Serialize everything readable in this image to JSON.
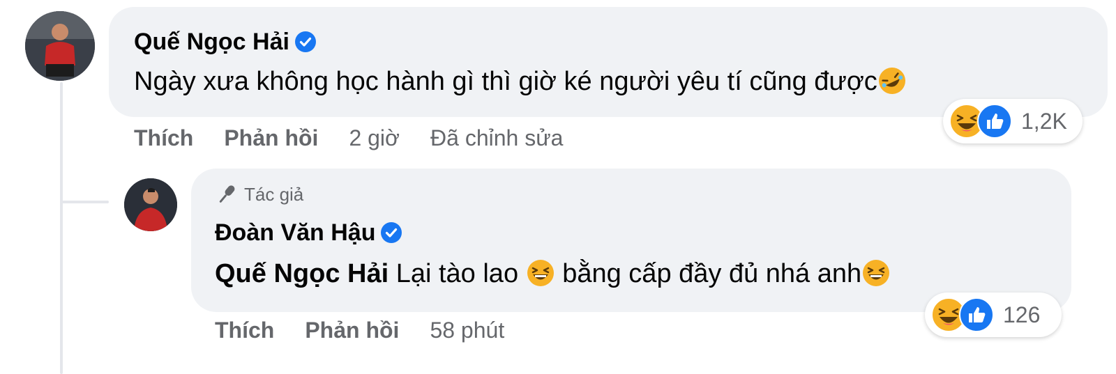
{
  "comment": {
    "author": "Quế Ngọc Hải",
    "text": "Ngày xưa không học hành gì thì giờ ké người yêu tí cũng được",
    "reactions": {
      "count": "1,2K",
      "icons": [
        "haha-icon",
        "like-icon"
      ]
    },
    "actions": {
      "like_label": "Thích",
      "reply_label": "Phản hồi",
      "time": "2 giờ",
      "edited": "Đã chỉnh sửa"
    }
  },
  "reply": {
    "author_tag": "Tác giả",
    "author": "Đoàn Văn Hậu",
    "mention": "Quế Ngọc Hải",
    "text_part1": "Lại tào lao",
    "text_part2": "bằng cấp đầy đủ nhá anh",
    "reactions": {
      "count": "126",
      "icons": [
        "haha-icon",
        "like-icon"
      ]
    },
    "actions": {
      "like_label": "Thích",
      "reply_label": "Phản hồi",
      "time": "58 phút"
    }
  },
  "colors": {
    "bubble": "#f0f2f5",
    "verified": "#1877f2",
    "secondary_text": "#65676b",
    "haha": "#f7b125",
    "like": "#1877f2"
  }
}
